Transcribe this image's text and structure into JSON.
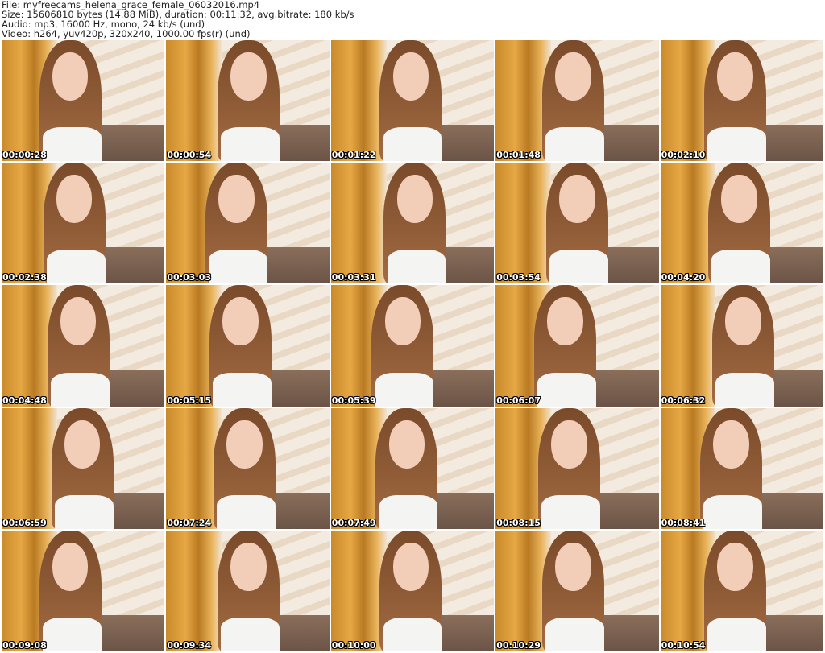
{
  "header": {
    "file": "File: myfreecams_helena_grace_female_06032016.mp4",
    "size": "Size: 15606810 bytes (14.88 MiB), duration: 00:11:32, avg.bitrate: 180 kb/s",
    "audio": "Audio: mp3, 16000 Hz, mono, 24 kb/s (und)",
    "video": "Video: h264, yuv420p, 320x240, 1000.00 fps(r) (und)"
  },
  "thumbnails": [
    "00:00:28",
    "00:00:54",
    "00:01:22",
    "00:01:48",
    "00:02:10",
    "00:02:38",
    "00:03:03",
    "00:03:31",
    "00:03:54",
    "00:04:20",
    "00:04:48",
    "00:05:15",
    "00:05:39",
    "00:06:07",
    "00:06:32",
    "00:06:59",
    "00:07:24",
    "00:07:49",
    "00:08:15",
    "00:08:41",
    "00:09:08",
    "00:09:34",
    "00:10:00",
    "00:10:29",
    "00:10:54"
  ]
}
